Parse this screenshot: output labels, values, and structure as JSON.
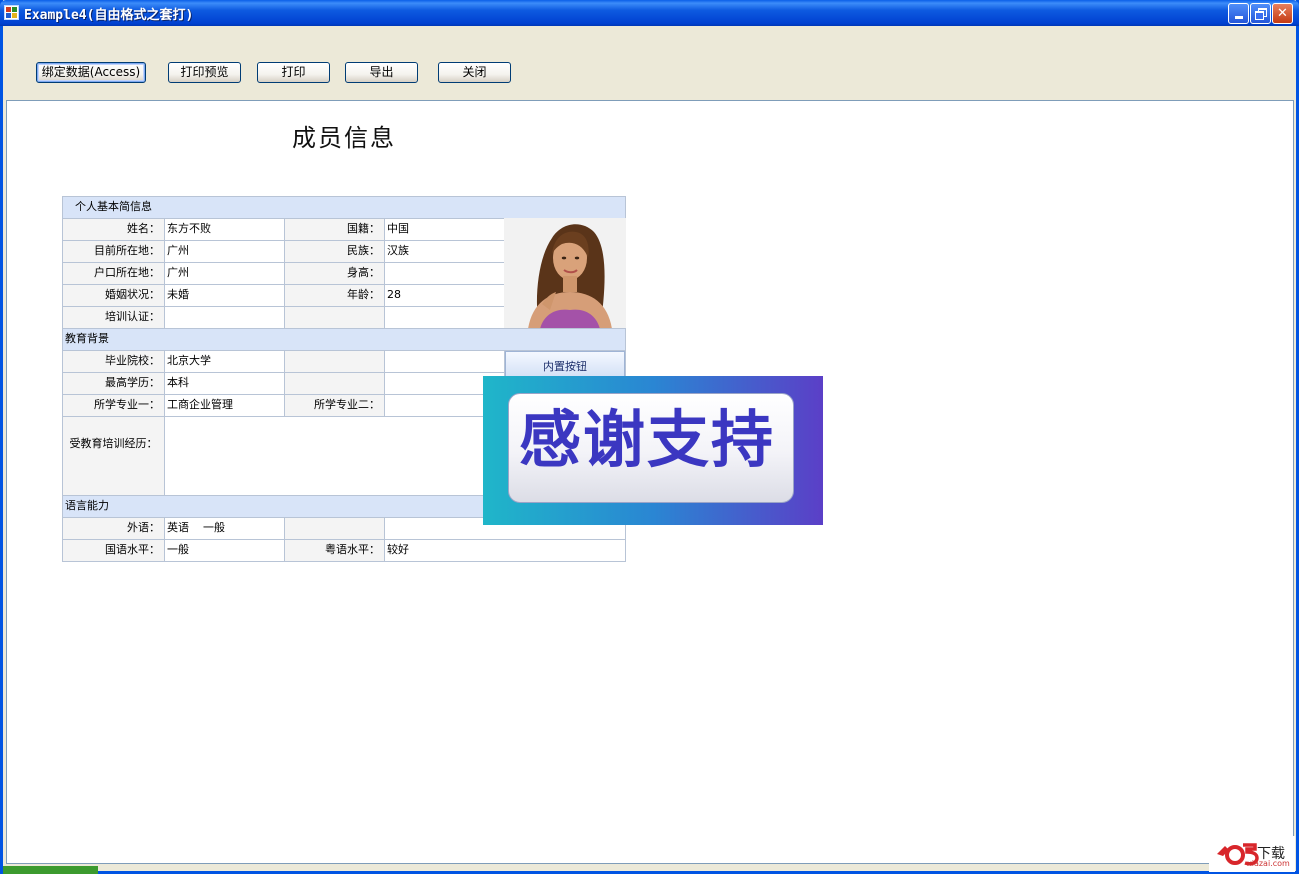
{
  "window": {
    "title": "Example4(自由格式之套打)",
    "icon": "application-icon",
    "controls": {
      "minimize": "minimize-icon",
      "maximize": "restore-icon",
      "close": "✕"
    }
  },
  "toolbar": {
    "bind_label": "绑定数据(Access)",
    "preview_label": "打印预览",
    "print_label": "打印",
    "export_label": "导出",
    "close_label": "关闭"
  },
  "report": {
    "title": "成员信息",
    "sections": {
      "basic": "个人基本简信息",
      "education": "教育背景",
      "language": "语言能力"
    },
    "labels": {
      "name": "姓名：",
      "nationality": "国籍：",
      "location": "目前所在地：",
      "ethnicity": "民族：",
      "hukou": "户口所在地：",
      "height": "身高：",
      "marital": "婚姻状况：",
      "age": "年龄：",
      "training_cert": "培训认证：",
      "school": "毕业院校：",
      "degree": "最高学历：",
      "major1": "所学专业一：",
      "major2": "所学专业二：",
      "training_history": "受教育培训经历：",
      "foreign_lang": "外语：",
      "mandarin": "国语水平：",
      "cantonese": "粤语水平："
    },
    "values": {
      "name": "东方不败",
      "nationality": "中国",
      "location": "广州",
      "ethnicity": "汉族",
      "hukou": "广州",
      "height": "",
      "marital": "未婚",
      "age": "28",
      "training_cert": "",
      "school": "北京大学",
      "degree": "本科",
      "major1": "工商企业管理",
      "major2": "",
      "training_history": "",
      "foreign_lang": "英语    一般",
      "mandarin": "一般",
      "cantonese": "较好"
    },
    "inner_button": "内置按钮"
  },
  "overlay": {
    "text": "感谢支持"
  },
  "watermark": {
    "brand": "下载",
    "sub": "xiazai.com"
  },
  "colors": {
    "section_bg": "#d8e4f8",
    "label_bg": "#f4f4f4",
    "grid_border": "#b8c4d6",
    "banner_text": "#3b37c1",
    "titlebar": "#0041d1"
  }
}
